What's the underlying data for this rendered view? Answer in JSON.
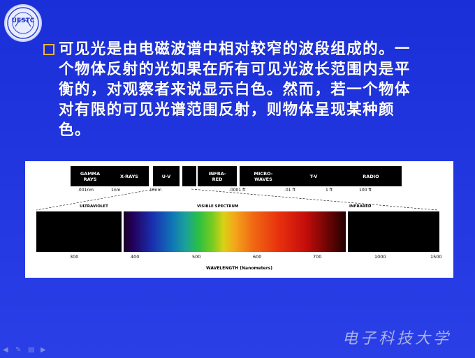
{
  "logo": {
    "text": "UESTC"
  },
  "slide": {
    "paragraph": "可见光是由电磁波谱中相对较窄的波段组成的。一个物体反射的光如果在所有可见光波长范围内是平衡的，对观察者来说显示白色。然而，若一个物体对有限的可见光谱范围反射，则物体呈现某种颜色。"
  },
  "figure": {
    "bands": [
      {
        "line1": "GAMMA",
        "line2": "RAYS"
      },
      {
        "line1": "X-RAYS",
        "line2": ""
      },
      {
        "line1": "U-V",
        "line2": ""
      },
      {
        "line1": "",
        "line2": ""
      },
      {
        "line1": "INFRA-",
        "line2": "RED"
      },
      {
        "line1": "MICRO-",
        "line2": "WAVES"
      },
      {
        "line1": "T-V",
        "line2": ""
      },
      {
        "line1": "RADIO",
        "line2": ""
      }
    ],
    "band_ticks": [
      ".001nm",
      "1nm",
      "10nm",
      ".0001 ft",
      ".01 ft",
      "1 ft",
      "100 ft"
    ],
    "sections": {
      "uv": "ULTRAVIOLET",
      "visible": "VISIBLE SPECTRUM",
      "ir": "INFRARED"
    },
    "axis_ticks": [
      "300",
      "400",
      "500",
      "600",
      "700",
      "1000",
      "1500"
    ],
    "axis_label": "WAVELENGTH (Nanometers)"
  },
  "footer": {
    "university": "电子科技大学"
  },
  "colors": {
    "background": "#2236e0",
    "bullet_border": "#f2b53a",
    "text": "#ffffff"
  }
}
